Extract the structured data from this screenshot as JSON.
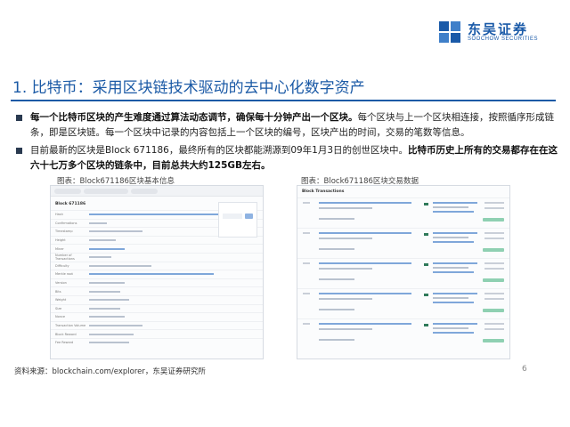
{
  "header": {
    "logo_cn": "东吴证券",
    "logo_en": "SOOCHOW SECURITIES"
  },
  "title": "1. 比特币：采用区块链技术驱动的去中心化数字资产",
  "bullets": [
    {
      "bold": "每一个比特币区块的产生难度通过算法动态调节，确保每十分钟产出一个区块。",
      "rest": "每个区块与上一个区块相连接，按照循序形成链条，即是区块链。每一个区块中记录的内容包括上一个区块的编号，区块产出的时间，交易的笔数等信息。"
    },
    {
      "pre": "目前最新的区块是Block 671186，最终所有的区块都能溯源到09年1月3日的创世区块中。",
      "bold": "比特币历史上所有的交易都存在在这六十七万多个区块的链条中，目前总共大约125GB左右。"
    }
  ],
  "captions": {
    "left": "图表：Block671186区块基本信息",
    "right": "图表：Block671186区块交易数据"
  },
  "left_shot": {
    "heading": "Block 671186",
    "row_labels": [
      "Hash",
      "Confirmations",
      "Timestamp",
      "Height",
      "Miner",
      "Number of Transactions",
      "Difficulty",
      "Merkle root",
      "Version",
      "Bits",
      "Weight",
      "Size",
      "Nonce",
      "Transaction Volume",
      "Block Reward",
      "Fee Reward"
    ]
  },
  "right_shot": {
    "heading": "Block Transactions"
  },
  "footer": {
    "source": "资料来源：blockchain.com/explorer，东吴证券研究所",
    "page": "6"
  }
}
